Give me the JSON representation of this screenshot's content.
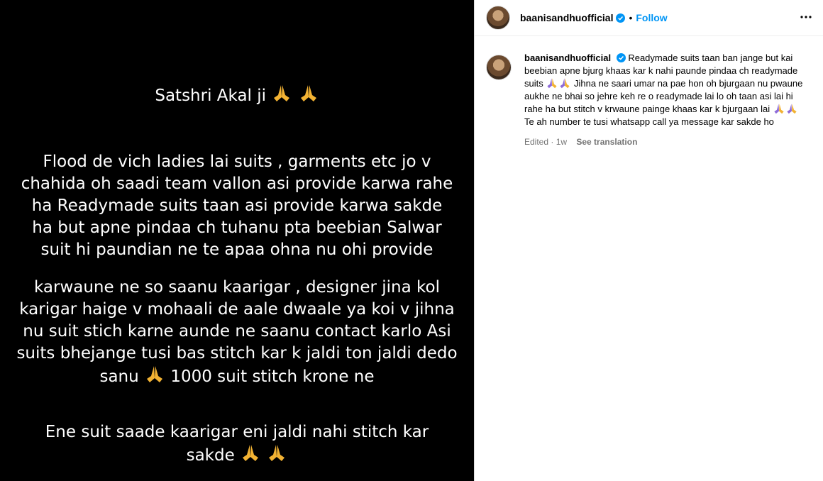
{
  "media": {
    "lines": [
      {
        "text": "Satshri Akal ji",
        "emoji": 2
      },
      {
        "text": "Flood de vich ladies lai suits , garments etc jo v"
      },
      {
        "text": "chahida oh saadi team vallon asi provide karwa rahe"
      },
      {
        "text": "ha Readymade suits taan asi provide karwa sakde"
      },
      {
        "text": "ha but apne pindaa ch tuhanu pta beebian Salwar"
      },
      {
        "text": "suit hi paundian ne te apaa ohna nu ohi provide"
      },
      {
        "text": "karwaune ne so saanu kaarigar , designer jina kol"
      },
      {
        "text": "karigar haige v mohaali de aale dwaale ya koi v jihna"
      },
      {
        "text": "nu suit stich karne aunde ne saanu contact karlo Asi"
      },
      {
        "text": "suits bhejange tusi bas stitch kar k jaldi ton jaldi dedo"
      },
      {
        "text_before": "sanu",
        "text_after": "1000 suit stitch krone ne",
        "emoji_mid": 1
      },
      {
        "text": "Ene suit saade kaarigar eni jaldi nahi stitch kar"
      },
      {
        "text": "sakde",
        "emoji": 2
      }
    ]
  },
  "header": {
    "username": "baanisandhuofficial",
    "separator": "•",
    "follow_label": "Follow",
    "more_icon": "more-options-icon"
  },
  "comment": {
    "username": "baanisandhuofficial",
    "text_1": "Readymade suits taan ban jange but kai beebian apne bjurg khaas kar k nahi paunde pindaa ch readymade suits",
    "text_2": "Jihna ne saari umar na pae hon oh bjurgaan nu pwaune aukhe ne bhai so jehre keh re o readymade lai lo oh taan asi lai hi rahe ha but stitch v krwaune painge khaas kar k bjurgaan lai",
    "text_3": "Te ah number te tusi whatsapp call ya message kar sakde ho",
    "meta_edited": "Edited · 1w",
    "see_translation": "See translation"
  },
  "colors": {
    "accent": "#0095f6",
    "verified": "#0095f6",
    "media_bg": "#000000",
    "muted": "#737373"
  }
}
